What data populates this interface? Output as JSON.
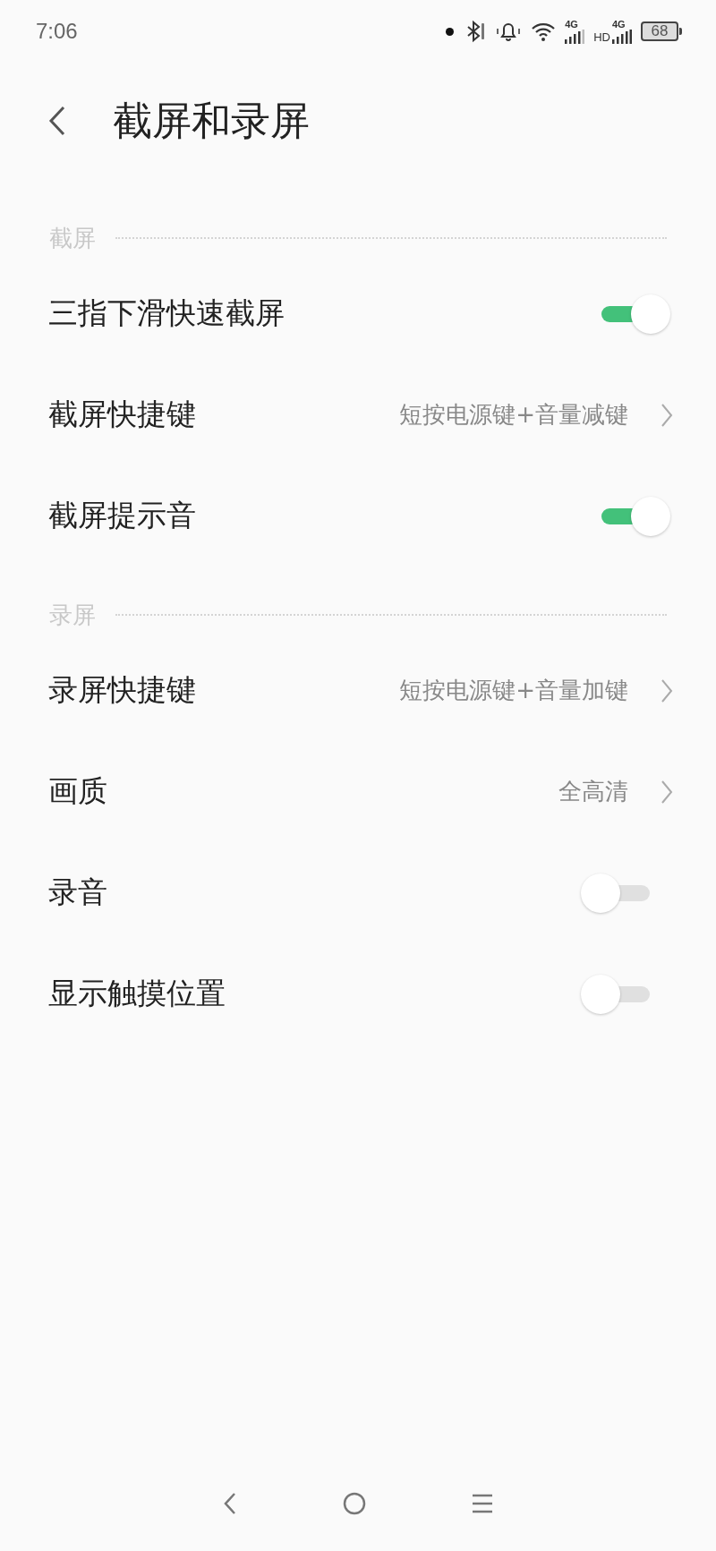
{
  "status_bar": {
    "time": "7:06",
    "sim1_label": "4G",
    "hd_label": "HD",
    "sim2_label": "4G",
    "battery": "68"
  },
  "header": {
    "title": "截屏和录屏"
  },
  "sections": [
    {
      "title": "截屏",
      "items": [
        {
          "kind": "toggle",
          "label": "三指下滑快速截屏",
          "on": true
        },
        {
          "kind": "link",
          "label": "截屏快捷键",
          "value": "短按电源键+音量减键"
        },
        {
          "kind": "toggle",
          "label": "截屏提示音",
          "on": true
        }
      ]
    },
    {
      "title": "录屏",
      "items": [
        {
          "kind": "link",
          "label": "录屏快捷键",
          "value": "短按电源键+音量加键"
        },
        {
          "kind": "link",
          "label": "画质",
          "value": "全高清"
        },
        {
          "kind": "toggle",
          "label": "录音",
          "on": false
        },
        {
          "kind": "toggle",
          "label": "显示触摸位置",
          "on": false
        }
      ]
    }
  ]
}
